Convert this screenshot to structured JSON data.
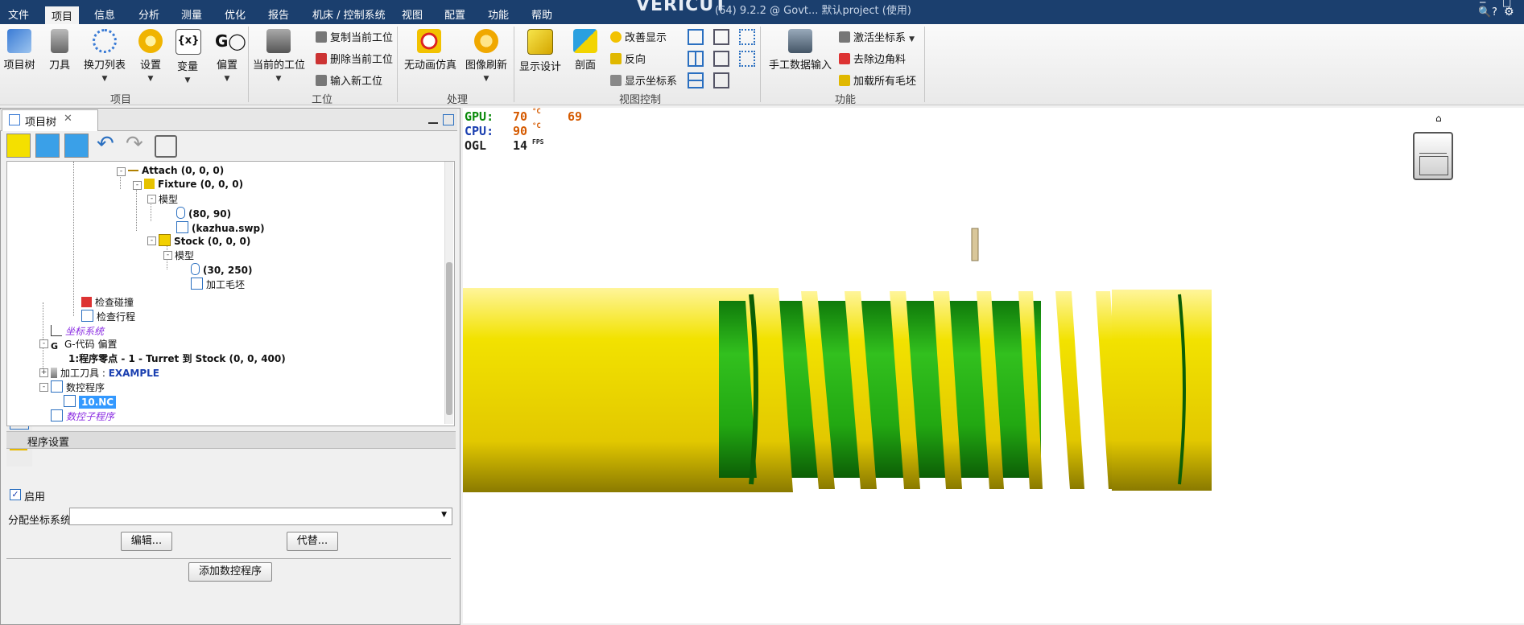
{
  "app": {
    "title": "VERICUT",
    "project_label": "(64) 9.2.2 @ Govt... 默认project (使用)"
  },
  "menu": [
    "文件",
    "项目",
    "信息",
    "分析",
    "测量",
    "优化",
    "报告",
    "机床 / 控制系统",
    "视图",
    "配置",
    "功能",
    "帮助"
  ],
  "menu_active": "项目",
  "ribbon": {
    "project_group": {
      "label": "项目",
      "buttons": [
        "项目树",
        "刀具",
        "换刀列表",
        "设置",
        "变量",
        "偏置"
      ]
    },
    "setup_group": {
      "label": "工位",
      "current": "当前的工位",
      "small": [
        "复制当前工位",
        "删除当前工位",
        "输入新工位"
      ]
    },
    "process_group": {
      "label": "处理",
      "buttons": [
        "无动画仿真",
        "图像刷新"
      ]
    },
    "view_group": {
      "label": "视图控制",
      "buttons": [
        "显示设计",
        "剖面"
      ],
      "small": [
        "改善显示",
        "反向",
        "显示坐标系"
      ]
    },
    "function_group": {
      "label": "功能",
      "buttons": [
        "手工数据输入"
      ],
      "small": [
        "激活坐标系",
        "去除边角料",
        "加载所有毛坯"
      ]
    }
  },
  "panel": {
    "tab_title": "项目树"
  },
  "tree": {
    "attach": "Attach (0, 0, 0)",
    "fixture": "Fixture (0, 0, 0)",
    "model1": "模型",
    "cyl1": "(80, 90)",
    "swp": "(kazhua.swp)",
    "stock": "Stock (0, 0, 0)",
    "model2": "模型",
    "cyl2": "(30, 250)",
    "blank": "加工毛坯",
    "collision": "检查碰撞",
    "travel": "检查行程",
    "coord": "坐标系统",
    "gcode_offset": "G-代码 偏置",
    "offset_item": "1:程序零点 - 1 - Turret 到 Stock (0, 0, 400)",
    "tool_label": "加工刀具 : ",
    "tool_name": "EXAMPLE",
    "nc_programs": "数控程序",
    "nc_file": "10.NC",
    "nc_sub": "数控子程序"
  },
  "settings": {
    "section_title": "程序设置",
    "enable_label": "启用",
    "enabled": true,
    "coord_label": "分配坐标系统",
    "coord_value": "",
    "edit_button": "编辑...",
    "replace_button": "代替...",
    "add_button": "添加数控程序"
  },
  "stats": {
    "gpu_label": "GPU:",
    "gpu_val": "70",
    "gpu_unit": "°C",
    "gpu_extra": "69",
    "cpu_label": "CPU:",
    "cpu_val": "90",
    "cpu_unit": "°C",
    "ogl_label": "OGL",
    "ogl_val": "14",
    "ogl_unit": "FPS"
  },
  "colors": {
    "menubar": "#1b3f6e",
    "stock": "#f2e200",
    "cut": "#1fa812",
    "accent": "#1e7ac8"
  }
}
